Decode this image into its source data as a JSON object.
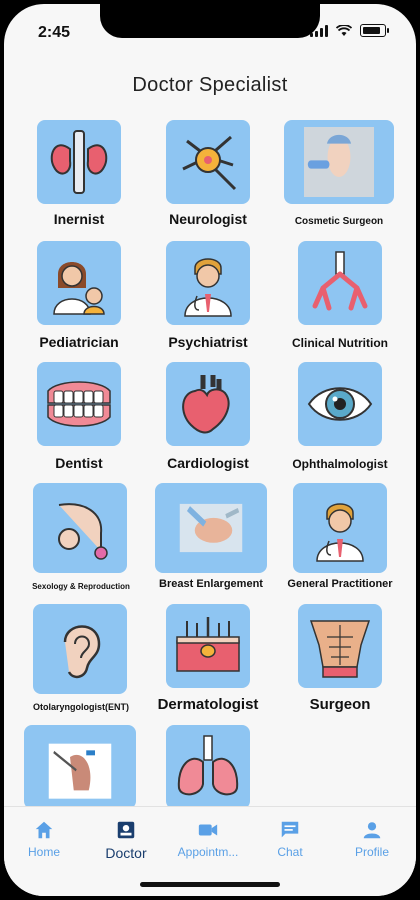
{
  "status": {
    "time": "2:45"
  },
  "title": "Doctor Specialist",
  "specialists": [
    {
      "label": "Inernist",
      "icon": "kidneys-icon"
    },
    {
      "label": "Neurologist",
      "icon": "neuron-icon"
    },
    {
      "label": "Cosmetic Surgeon",
      "icon": "cosmetic-face-photo"
    },
    {
      "label": "Pediatrician",
      "icon": "pediatrician-icon"
    },
    {
      "label": "Psychiatrist",
      "icon": "doctor-icon"
    },
    {
      "label": "Clinical Nutrition",
      "icon": "lungs-bronchi-icon"
    },
    {
      "label": "Dentist",
      "icon": "teeth-icon"
    },
    {
      "label": "Cardiologist",
      "icon": "heart-icon"
    },
    {
      "label": "Ophthalmologist",
      "icon": "eye-icon"
    },
    {
      "label": "Sexology & Reproduction",
      "icon": "reproduction-icon"
    },
    {
      "label": "Breast Enlargement",
      "icon": "surgery-photo"
    },
    {
      "label": "General Practitioner",
      "icon": "doctor-icon"
    },
    {
      "label": "Otolaryngologist(ENT)",
      "icon": "ear-icon"
    },
    {
      "label": "Dermatologist",
      "icon": "skin-icon"
    },
    {
      "label": "Surgeon",
      "icon": "torso-icon"
    },
    {
      "label": "",
      "icon": "orthopedic-photo"
    },
    {
      "label": "",
      "icon": "lungs-icon"
    }
  ],
  "tabs": [
    {
      "label": "Home",
      "icon": "home-icon",
      "active": false
    },
    {
      "label": "Doctor",
      "icon": "doctor-badge-icon",
      "active": true
    },
    {
      "label": "Appointm...",
      "icon": "video-icon",
      "active": false
    },
    {
      "label": "Chat",
      "icon": "chat-icon",
      "active": false
    },
    {
      "label": "Profile",
      "icon": "profile-icon",
      "active": false
    }
  ],
  "colors": {
    "tile": "#8ec5f2",
    "tab_active": "#1a3e6e",
    "tab_inactive": "#5aa0e6"
  }
}
